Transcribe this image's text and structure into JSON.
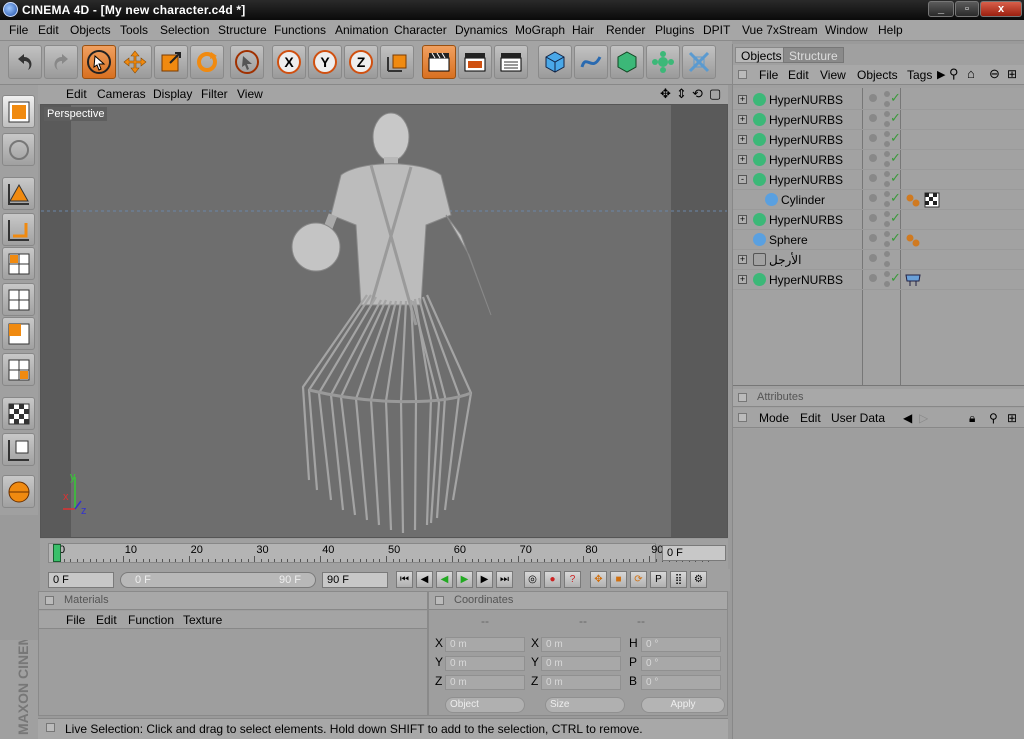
{
  "window": {
    "title": "CINEMA 4D - [My new character.c4d *]",
    "min": "_",
    "max": "▫",
    "close": "x"
  },
  "menubar": [
    "File",
    "Edit",
    "Objects",
    "Tools",
    "Selection",
    "Structure",
    "Functions",
    "Animation",
    "Character",
    "Dynamics",
    "MoGraph",
    "Hair",
    "Render",
    "Plugins",
    "DPIT",
    "Vue 7xStream",
    "Window",
    "Help"
  ],
  "viewport": {
    "menu": [
      "Edit",
      "Cameras",
      "Display",
      "Filter",
      "View"
    ],
    "label": "Perspective",
    "axis": {
      "y": "y",
      "x": "x",
      "z": "z"
    }
  },
  "timeline": {
    "ticks": [
      "0",
      "10",
      "20",
      "30",
      "40",
      "50",
      "60",
      "70",
      "80",
      "90"
    ],
    "current": "0 F",
    "progress_fraction": 0.0
  },
  "playbar": {
    "start": "0 F",
    "range_start": "0 F",
    "range_end": "90 F",
    "end": "90 F"
  },
  "materials": {
    "header": "Materials",
    "menu": [
      "File",
      "Edit",
      "Function",
      "Texture"
    ]
  },
  "coords": {
    "header": "Coordinates",
    "dashes": [
      "--",
      "--",
      "--"
    ],
    "rows": [
      {
        "l1": "X",
        "v1": "0 m",
        "l2": "X",
        "v2": "0 m",
        "l3": "H",
        "v3": "0 °"
      },
      {
        "l1": "Y",
        "v1": "0 m",
        "l2": "Y",
        "v2": "0 m",
        "l3": "P",
        "v3": "0 °"
      },
      {
        "l1": "Z",
        "v1": "0 m",
        "l2": "Z",
        "v2": "0 m",
        "l3": "B",
        "v3": "0 °"
      }
    ],
    "mode": "Object",
    "size": "Size",
    "apply": "Apply"
  },
  "status": "Live Selection: Click and drag to select elements. Hold down SHIFT to add to the selection, CTRL to remove.",
  "brand": "MAXON CINEMA 4D",
  "objects_panel": {
    "tabs": [
      "Objects",
      "Structure"
    ],
    "menu": [
      "File",
      "Edit",
      "View",
      "Objects",
      "Tags"
    ],
    "items": [
      {
        "name": "HyperNURBS",
        "exp": "+",
        "icon": "hypernurbs-icon",
        "color": "#3cb878",
        "indent": 0,
        "check": "✓",
        "tag": ""
      },
      {
        "name": "HyperNURBS",
        "exp": "+",
        "icon": "hypernurbs-icon",
        "color": "#3cb878",
        "indent": 0,
        "check": "✓",
        "tag": ""
      },
      {
        "name": "HyperNURBS",
        "exp": "+",
        "icon": "hypernurbs-icon",
        "color": "#3cb878",
        "indent": 0,
        "check": "✓",
        "tag": ""
      },
      {
        "name": "HyperNURBS",
        "exp": "+",
        "icon": "hypernurbs-icon",
        "color": "#3cb878",
        "indent": 0,
        "check": "✓",
        "tag": ""
      },
      {
        "name": "HyperNURBS",
        "exp": "-",
        "icon": "hypernurbs-icon",
        "color": "#3cb878",
        "indent": 0,
        "check": "✓",
        "tag": ""
      },
      {
        "name": "Cylinder",
        "exp": "",
        "icon": "cylinder-icon",
        "color": "#5aa0e0",
        "indent": 1,
        "check": "✓",
        "tag": "material"
      },
      {
        "name": "HyperNURBS",
        "exp": "+",
        "icon": "hypernurbs-icon",
        "color": "#3cb878",
        "indent": 0,
        "check": "✓",
        "tag": ""
      },
      {
        "name": "Sphere",
        "exp": "",
        "icon": "sphere-icon",
        "color": "#5aa0e0",
        "indent": 0,
        "check": "✓",
        "tag": "phong"
      },
      {
        "name": "الأرجل",
        "exp": "+",
        "icon": "null-icon",
        "color": "#777",
        "indent": 0,
        "check": "",
        "tag": ""
      },
      {
        "name": "HyperNURBS",
        "exp": "+",
        "icon": "hypernurbs-icon",
        "color": "#3cb878",
        "indent": 0,
        "check": "✓",
        "tag": "display"
      }
    ]
  },
  "attributes": {
    "header": "Attributes",
    "menu": [
      "Mode",
      "Edit",
      "User Data"
    ]
  }
}
